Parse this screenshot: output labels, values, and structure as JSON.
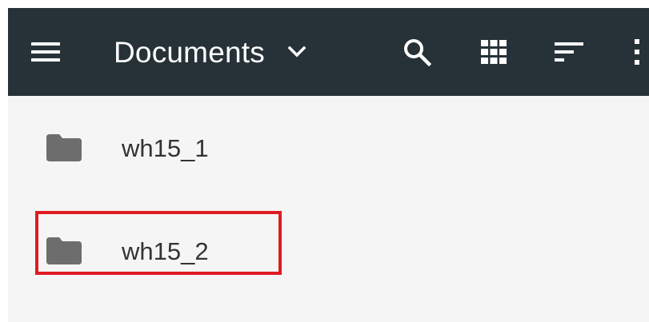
{
  "appbar": {
    "title": "Documents",
    "background_color": "#263238",
    "icons": {
      "menu": "hamburger-menu-icon",
      "dropdown": "chevron-down-icon",
      "search": "search-icon",
      "view": "grid-view-icon",
      "sort": "sort-icon",
      "more": "more-vert-icon"
    }
  },
  "list": {
    "items": [
      {
        "label": "wh15_1",
        "icon": "folder-icon"
      },
      {
        "label": "wh15_2",
        "icon": "folder-icon"
      }
    ]
  },
  "annotation": {
    "highlight_color": "#e01b24",
    "highlighted_item": "wh15_2"
  }
}
